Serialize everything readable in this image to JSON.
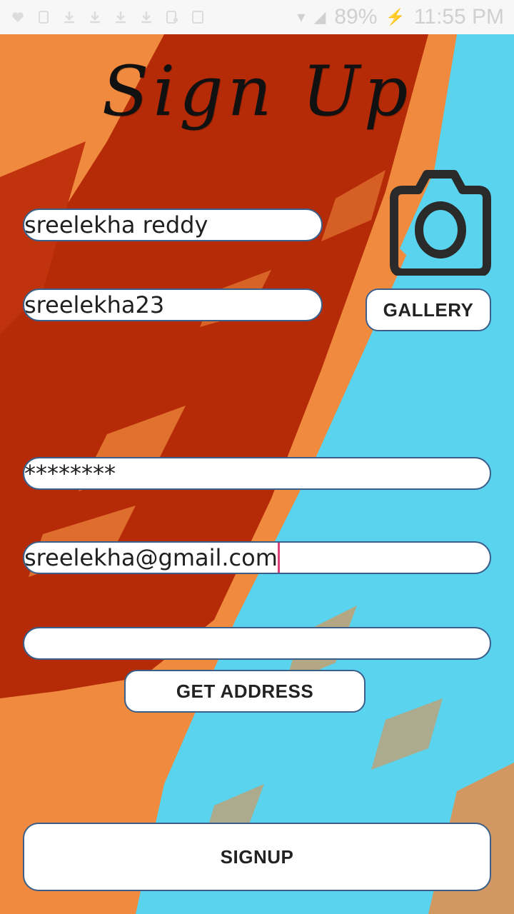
{
  "status_bar": {
    "battery": "89%",
    "time": "11:55 PM"
  },
  "title": "Sign Up",
  "form": {
    "name_value": "sreelekha reddy",
    "username_value": "sreelekha23",
    "password_value": "********",
    "email_value": "sreelekha@gmail.com",
    "address_value": ""
  },
  "buttons": {
    "gallery": "GALLERY",
    "get_address": "GET ADDRESS",
    "signup": "SIGNUP"
  },
  "icons": {
    "camera": "camera-icon"
  },
  "colors": {
    "orange": "#f08a3e",
    "red": "#b52a07",
    "cyan": "#5ad3ee",
    "field_border": "#3a5f8a",
    "caret": "#e0407a"
  }
}
